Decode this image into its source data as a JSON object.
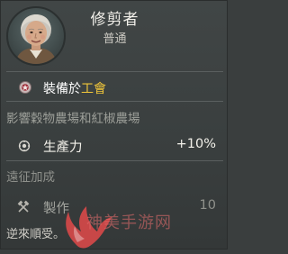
{
  "unit": {
    "name": "修剪者",
    "rarity": "普通",
    "portrait_icon": "old-woman-portrait"
  },
  "equip": {
    "icon": "badge-icon",
    "prefix": "裝備於",
    "building": "工會",
    "building_color": "#f0c63a"
  },
  "influence_text": "影響穀物農場和紅椒農場",
  "production": {
    "icon": "gear-icon",
    "label": "生產力",
    "value": "+10%"
  },
  "distant_label": "遠征加成",
  "crafting": {
    "icon": "crossed-hammer-icon",
    "label": "製作",
    "value": "10"
  },
  "footer_text": "逆來順受。",
  "watermark": {
    "text": "神美手游网",
    "color": "#e05050"
  }
}
